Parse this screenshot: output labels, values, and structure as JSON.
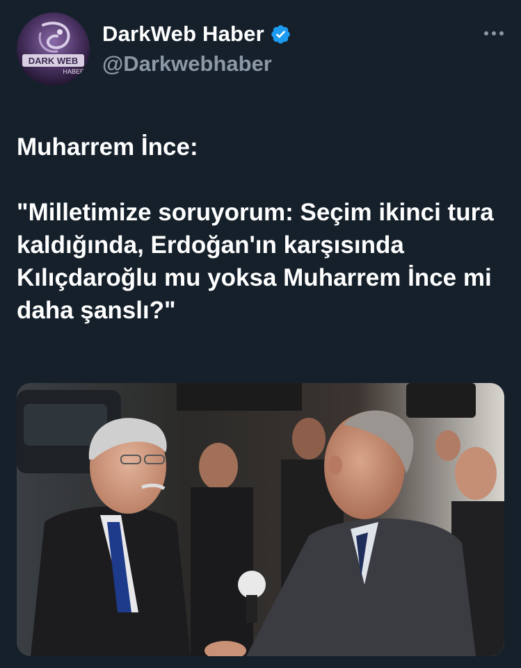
{
  "tweet": {
    "author": {
      "display_name": "DarkWeb Haber",
      "handle": "@Darkwebhaber",
      "verified": true,
      "avatar_text_top": "DARK WEB",
      "avatar_text_bottom": "HABER"
    },
    "text": "Muharrem İnce:\n\n\"Milletimize soruyorum: Seçim ikinci tura kaldığında, Erdoğan'ın karşısında Kılıçdaroğlu mu yoksa Muharrem İnce mi daha şanslı?\"",
    "more_icon": "more-horizontal-icon",
    "verified_icon": "verified-badge-icon"
  },
  "colors": {
    "background": "#15202b",
    "text_primary": "#ffffff",
    "text_secondary": "#8b98a5",
    "verified": "#1d9bf0"
  }
}
